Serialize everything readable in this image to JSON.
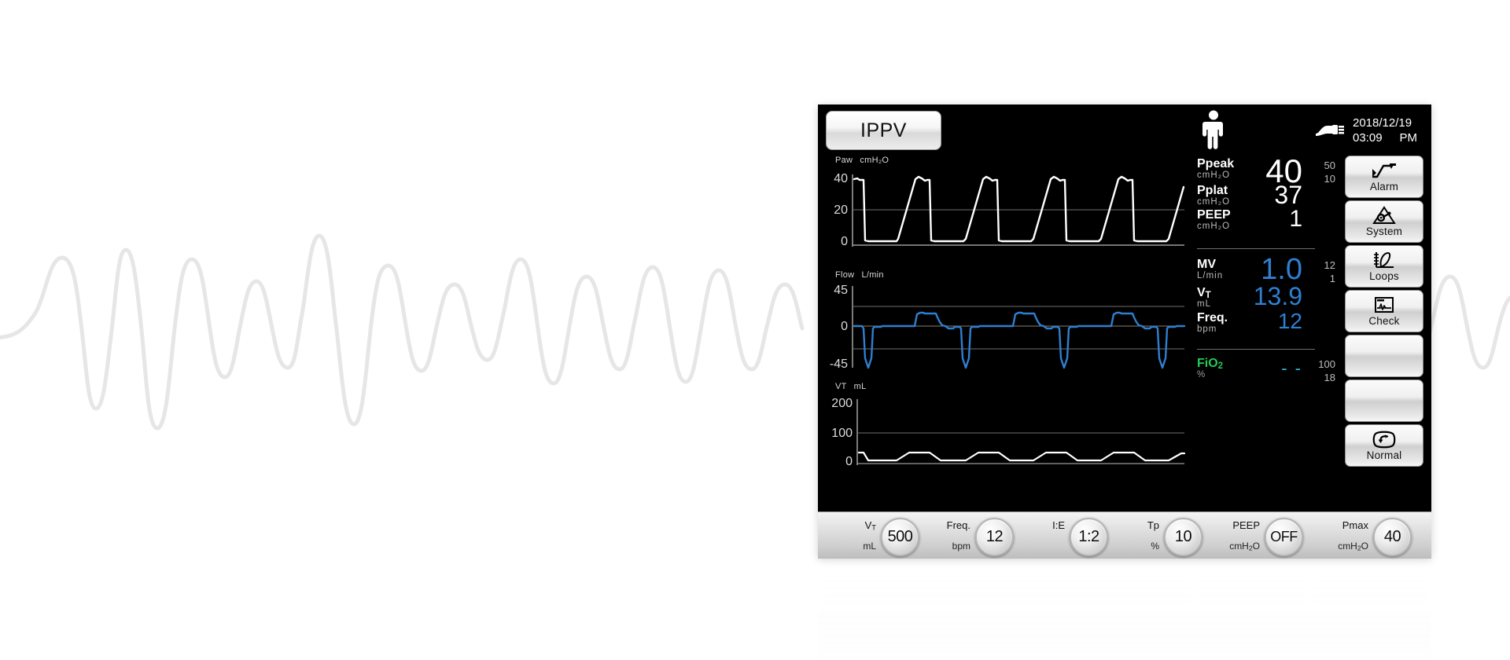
{
  "device": {
    "brand_color_blue": "#2f7fd1",
    "brand_color_green": "#22cc55",
    "screen_bg": "#000000"
  },
  "header": {
    "mode_label": "IPPV",
    "patient_icon": "adult-patient-icon",
    "power_icon": "ac-power-plug-icon",
    "date": "2018/12/19",
    "time": "03:09",
    "meridiem": "PM"
  },
  "waveforms": [
    {
      "name": "Paw",
      "unit": "cmH₂O",
      "ticks": [
        "40",
        "20",
        "0"
      ],
      "color": "#ffffff",
      "type": "pressure"
    },
    {
      "name": "Flow",
      "unit": "L/min",
      "ticks": [
        "45",
        "0",
        "-45"
      ],
      "color": "#2f7fd1",
      "type": "flow"
    },
    {
      "name": "VT",
      "unit": "mL",
      "ticks": [
        "200",
        "100",
        "0"
      ],
      "color": "#ffffff",
      "type": "volume"
    }
  ],
  "numerics": {
    "group_pressure": [
      {
        "label": "Ppeak",
        "unit": "cmH₂O",
        "value": "40",
        "size": 42,
        "color": "#ffffff",
        "limit_high": "50",
        "limit_low": "10"
      },
      {
        "label": "Pplat",
        "unit": "cmH₂O",
        "value": "37",
        "size": 32,
        "color": "#ffffff"
      },
      {
        "label": "PEEP",
        "unit": "cmH₂O",
        "value": "1",
        "size": 30,
        "color": "#ffffff"
      }
    ],
    "group_volume": [
      {
        "label": "MV",
        "unit": "L/min",
        "value": "1.0",
        "size": 38,
        "color": "#2f7fd1",
        "limit_high": "12",
        "limit_low": "1"
      },
      {
        "label": "VT",
        "unit": "mL",
        "value": "13.9",
        "size": 32,
        "color": "#2f7fd1"
      },
      {
        "label": "Freq.",
        "unit": "bpm",
        "value": "12",
        "size": 28,
        "color": "#2f7fd1"
      }
    ],
    "group_oxygen": [
      {
        "label": "FiO₂",
        "unit": "%",
        "value": "- -",
        "size": 22,
        "color": "#22cc55",
        "value_color": "#2fb5d8",
        "limit_high": "100",
        "limit_low": "18"
      }
    ]
  },
  "side_buttons": [
    {
      "label": "Alarm",
      "icon": "alarm-limit-icon"
    },
    {
      "label": "System",
      "icon": "system-gear-icon"
    },
    {
      "label": "Loops",
      "icon": "loops-graph-icon"
    },
    {
      "label": "Check",
      "icon": "check-waveform-icon"
    },
    {
      "label": "",
      "icon": ""
    },
    {
      "label": "",
      "icon": ""
    },
    {
      "label": "Normal",
      "icon": "normal-return-icon"
    }
  ],
  "parameters": [
    {
      "name": "Vᴛ",
      "unit": "mL",
      "value": "500"
    },
    {
      "name": "Freq.",
      "unit": "bpm",
      "value": "12"
    },
    {
      "name": "I:E",
      "unit": "",
      "value": "1:2"
    },
    {
      "name": "Tp",
      "unit": "%",
      "value": "10"
    },
    {
      "name": "PEEP",
      "unit": "cmH₂O",
      "value": "OFF"
    },
    {
      "name": "Pmax",
      "unit": "cmH₂O",
      "value": "40"
    }
  ]
}
